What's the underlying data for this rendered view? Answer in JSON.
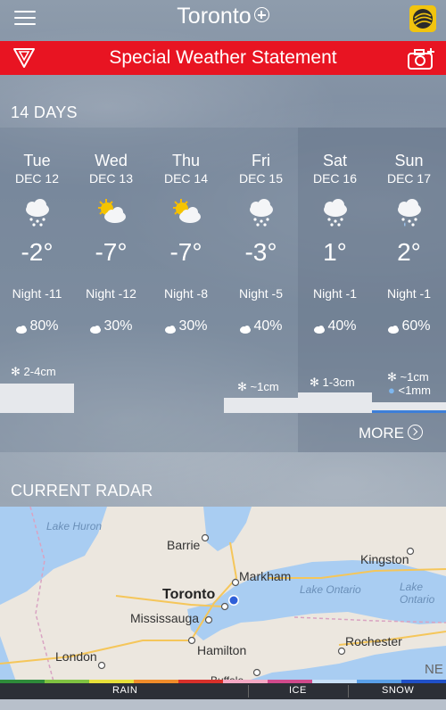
{
  "header": {
    "city": "Toronto"
  },
  "alert": {
    "text": "Special Weather Statement"
  },
  "forecast": {
    "section_title": "14 DAYS",
    "days": [
      {
        "day": "Tue",
        "date": "DEC 12",
        "icon": "snow-cloud-icon",
        "temp": "-2°",
        "night": "Night -11",
        "pop": "80%",
        "amount": "2-4cm",
        "amount_type": "snow"
      },
      {
        "day": "Wed",
        "date": "DEC 13",
        "icon": "sun-cloud-icon",
        "temp": "-7°",
        "night": "Night -12",
        "pop": "30%",
        "amount": "",
        "amount_type": ""
      },
      {
        "day": "Thu",
        "date": "DEC 14",
        "icon": "sun-cloud-icon",
        "temp": "-7°",
        "night": "Night -8",
        "pop": "30%",
        "amount": "",
        "amount_type": ""
      },
      {
        "day": "Fri",
        "date": "DEC 15",
        "icon": "snow-cloud-icon",
        "temp": "-3°",
        "night": "Night -5",
        "pop": "40%",
        "amount": "~1cm",
        "amount_type": "snow"
      },
      {
        "day": "Sat",
        "date": "DEC 16",
        "icon": "snow-cloud-icon",
        "temp": "1°",
        "night": "Night -1",
        "pop": "40%",
        "amount": "1-3cm",
        "amount_type": "snow"
      },
      {
        "day": "Sun",
        "date": "DEC 17",
        "icon": "snow-rain-cloud-icon",
        "temp": "2°",
        "night": "Night -1",
        "pop": "60%",
        "amount": "~1cm",
        "amount2": "<1mm",
        "amount_type": "snow-rain"
      }
    ],
    "more_label": "MORE"
  },
  "radar": {
    "section_title": "CURRENT RADAR",
    "places": [
      "Lake Huron",
      "Barrie",
      "Kingston",
      "Markham",
      "Toronto",
      "Lake Ontario",
      "Lake Ontario",
      "Mississauga",
      "Hamilton",
      "Rochester",
      "London",
      "Buffalo",
      "NE"
    ],
    "legend": [
      "RAIN",
      "ICE",
      "SNOW"
    ]
  }
}
